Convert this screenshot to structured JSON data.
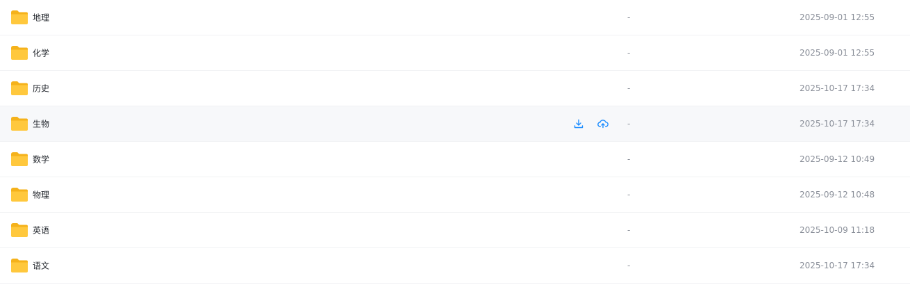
{
  "files": [
    {
      "name": "地理",
      "size": "-",
      "modified": "2025-09-01 12:55"
    },
    {
      "name": "化学",
      "size": "-",
      "modified": "2025-09-01 12:55"
    },
    {
      "name": "历史",
      "size": "-",
      "modified": "2025-10-17 17:34"
    },
    {
      "name": "生物",
      "size": "-",
      "modified": "2025-10-17 17:34",
      "hovered": true
    },
    {
      "name": "数学",
      "size": "-",
      "modified": "2025-09-12 10:49"
    },
    {
      "name": "物理",
      "size": "-",
      "modified": "2025-09-12 10:48"
    },
    {
      "name": "英语",
      "size": "-",
      "modified": "2025-10-09 11:18"
    },
    {
      "name": "语文",
      "size": "-",
      "modified": "2025-10-17 17:34"
    }
  ],
  "icons": {
    "folder": "folder-icon",
    "download": "download-icon",
    "cloud_save": "cloud-upload-icon"
  },
  "colors": {
    "folder_fill": "#FFC83D",
    "folder_back": "#F5B21B",
    "action_blue": "#1a8cff",
    "hover_bg": "#f7f8fa"
  }
}
